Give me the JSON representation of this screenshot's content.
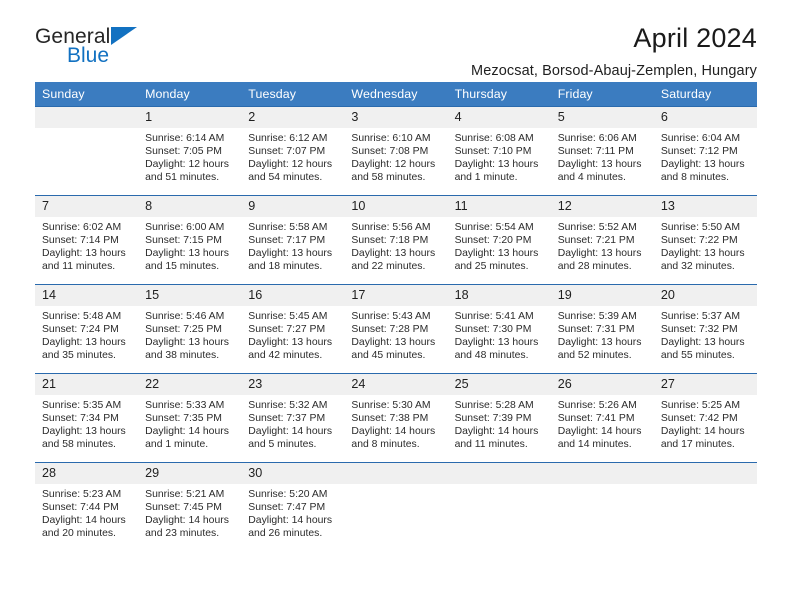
{
  "brand": {
    "name_top": "General",
    "name_bottom": "Blue",
    "accent_color": "#1271c1"
  },
  "header": {
    "month_title": "April 2024",
    "location": "Mezocsat, Borsod-Abauj-Zemplen, Hungary"
  },
  "calendar": {
    "header_bg": "#3b7cc0",
    "row_border": "#2a6aad",
    "daynum_bg": "#f0f0f0",
    "weekday_headers": [
      "Sunday",
      "Monday",
      "Tuesday",
      "Wednesday",
      "Thursday",
      "Friday",
      "Saturday"
    ],
    "weeks": [
      [
        {
          "day": "",
          "sunrise": "",
          "sunset": "",
          "daylight_line1": "",
          "daylight_line2": ""
        },
        {
          "day": "1",
          "sunrise": "Sunrise: 6:14 AM",
          "sunset": "Sunset: 7:05 PM",
          "daylight_line1": "Daylight: 12 hours",
          "daylight_line2": "and 51 minutes."
        },
        {
          "day": "2",
          "sunrise": "Sunrise: 6:12 AM",
          "sunset": "Sunset: 7:07 PM",
          "daylight_line1": "Daylight: 12 hours",
          "daylight_line2": "and 54 minutes."
        },
        {
          "day": "3",
          "sunrise": "Sunrise: 6:10 AM",
          "sunset": "Sunset: 7:08 PM",
          "daylight_line1": "Daylight: 12 hours",
          "daylight_line2": "and 58 minutes."
        },
        {
          "day": "4",
          "sunrise": "Sunrise: 6:08 AM",
          "sunset": "Sunset: 7:10 PM",
          "daylight_line1": "Daylight: 13 hours",
          "daylight_line2": "and 1 minute."
        },
        {
          "day": "5",
          "sunrise": "Sunrise: 6:06 AM",
          "sunset": "Sunset: 7:11 PM",
          "daylight_line1": "Daylight: 13 hours",
          "daylight_line2": "and 4 minutes."
        },
        {
          "day": "6",
          "sunrise": "Sunrise: 6:04 AM",
          "sunset": "Sunset: 7:12 PM",
          "daylight_line1": "Daylight: 13 hours",
          "daylight_line2": "and 8 minutes."
        }
      ],
      [
        {
          "day": "7",
          "sunrise": "Sunrise: 6:02 AM",
          "sunset": "Sunset: 7:14 PM",
          "daylight_line1": "Daylight: 13 hours",
          "daylight_line2": "and 11 minutes."
        },
        {
          "day": "8",
          "sunrise": "Sunrise: 6:00 AM",
          "sunset": "Sunset: 7:15 PM",
          "daylight_line1": "Daylight: 13 hours",
          "daylight_line2": "and 15 minutes."
        },
        {
          "day": "9",
          "sunrise": "Sunrise: 5:58 AM",
          "sunset": "Sunset: 7:17 PM",
          "daylight_line1": "Daylight: 13 hours",
          "daylight_line2": "and 18 minutes."
        },
        {
          "day": "10",
          "sunrise": "Sunrise: 5:56 AM",
          "sunset": "Sunset: 7:18 PM",
          "daylight_line1": "Daylight: 13 hours",
          "daylight_line2": "and 22 minutes."
        },
        {
          "day": "11",
          "sunrise": "Sunrise: 5:54 AM",
          "sunset": "Sunset: 7:20 PM",
          "daylight_line1": "Daylight: 13 hours",
          "daylight_line2": "and 25 minutes."
        },
        {
          "day": "12",
          "sunrise": "Sunrise: 5:52 AM",
          "sunset": "Sunset: 7:21 PM",
          "daylight_line1": "Daylight: 13 hours",
          "daylight_line2": "and 28 minutes."
        },
        {
          "day": "13",
          "sunrise": "Sunrise: 5:50 AM",
          "sunset": "Sunset: 7:22 PM",
          "daylight_line1": "Daylight: 13 hours",
          "daylight_line2": "and 32 minutes."
        }
      ],
      [
        {
          "day": "14",
          "sunrise": "Sunrise: 5:48 AM",
          "sunset": "Sunset: 7:24 PM",
          "daylight_line1": "Daylight: 13 hours",
          "daylight_line2": "and 35 minutes."
        },
        {
          "day": "15",
          "sunrise": "Sunrise: 5:46 AM",
          "sunset": "Sunset: 7:25 PM",
          "daylight_line1": "Daylight: 13 hours",
          "daylight_line2": "and 38 minutes."
        },
        {
          "day": "16",
          "sunrise": "Sunrise: 5:45 AM",
          "sunset": "Sunset: 7:27 PM",
          "daylight_line1": "Daylight: 13 hours",
          "daylight_line2": "and 42 minutes."
        },
        {
          "day": "17",
          "sunrise": "Sunrise: 5:43 AM",
          "sunset": "Sunset: 7:28 PM",
          "daylight_line1": "Daylight: 13 hours",
          "daylight_line2": "and 45 minutes."
        },
        {
          "day": "18",
          "sunrise": "Sunrise: 5:41 AM",
          "sunset": "Sunset: 7:30 PM",
          "daylight_line1": "Daylight: 13 hours",
          "daylight_line2": "and 48 minutes."
        },
        {
          "day": "19",
          "sunrise": "Sunrise: 5:39 AM",
          "sunset": "Sunset: 7:31 PM",
          "daylight_line1": "Daylight: 13 hours",
          "daylight_line2": "and 52 minutes."
        },
        {
          "day": "20",
          "sunrise": "Sunrise: 5:37 AM",
          "sunset": "Sunset: 7:32 PM",
          "daylight_line1": "Daylight: 13 hours",
          "daylight_line2": "and 55 minutes."
        }
      ],
      [
        {
          "day": "21",
          "sunrise": "Sunrise: 5:35 AM",
          "sunset": "Sunset: 7:34 PM",
          "daylight_line1": "Daylight: 13 hours",
          "daylight_line2": "and 58 minutes."
        },
        {
          "day": "22",
          "sunrise": "Sunrise: 5:33 AM",
          "sunset": "Sunset: 7:35 PM",
          "daylight_line1": "Daylight: 14 hours",
          "daylight_line2": "and 1 minute."
        },
        {
          "day": "23",
          "sunrise": "Sunrise: 5:32 AM",
          "sunset": "Sunset: 7:37 PM",
          "daylight_line1": "Daylight: 14 hours",
          "daylight_line2": "and 5 minutes."
        },
        {
          "day": "24",
          "sunrise": "Sunrise: 5:30 AM",
          "sunset": "Sunset: 7:38 PM",
          "daylight_line1": "Daylight: 14 hours",
          "daylight_line2": "and 8 minutes."
        },
        {
          "day": "25",
          "sunrise": "Sunrise: 5:28 AM",
          "sunset": "Sunset: 7:39 PM",
          "daylight_line1": "Daylight: 14 hours",
          "daylight_line2": "and 11 minutes."
        },
        {
          "day": "26",
          "sunrise": "Sunrise: 5:26 AM",
          "sunset": "Sunset: 7:41 PM",
          "daylight_line1": "Daylight: 14 hours",
          "daylight_line2": "and 14 minutes."
        },
        {
          "day": "27",
          "sunrise": "Sunrise: 5:25 AM",
          "sunset": "Sunset: 7:42 PM",
          "daylight_line1": "Daylight: 14 hours",
          "daylight_line2": "and 17 minutes."
        }
      ],
      [
        {
          "day": "28",
          "sunrise": "Sunrise: 5:23 AM",
          "sunset": "Sunset: 7:44 PM",
          "daylight_line1": "Daylight: 14 hours",
          "daylight_line2": "and 20 minutes."
        },
        {
          "day": "29",
          "sunrise": "Sunrise: 5:21 AM",
          "sunset": "Sunset: 7:45 PM",
          "daylight_line1": "Daylight: 14 hours",
          "daylight_line2": "and 23 minutes."
        },
        {
          "day": "30",
          "sunrise": "Sunrise: 5:20 AM",
          "sunset": "Sunset: 7:47 PM",
          "daylight_line1": "Daylight: 14 hours",
          "daylight_line2": "and 26 minutes."
        },
        {
          "day": "",
          "sunrise": "",
          "sunset": "",
          "daylight_line1": "",
          "daylight_line2": ""
        },
        {
          "day": "",
          "sunrise": "",
          "sunset": "",
          "daylight_line1": "",
          "daylight_line2": ""
        },
        {
          "day": "",
          "sunrise": "",
          "sunset": "",
          "daylight_line1": "",
          "daylight_line2": ""
        },
        {
          "day": "",
          "sunrise": "",
          "sunset": "",
          "daylight_line1": "",
          "daylight_line2": ""
        }
      ]
    ]
  }
}
